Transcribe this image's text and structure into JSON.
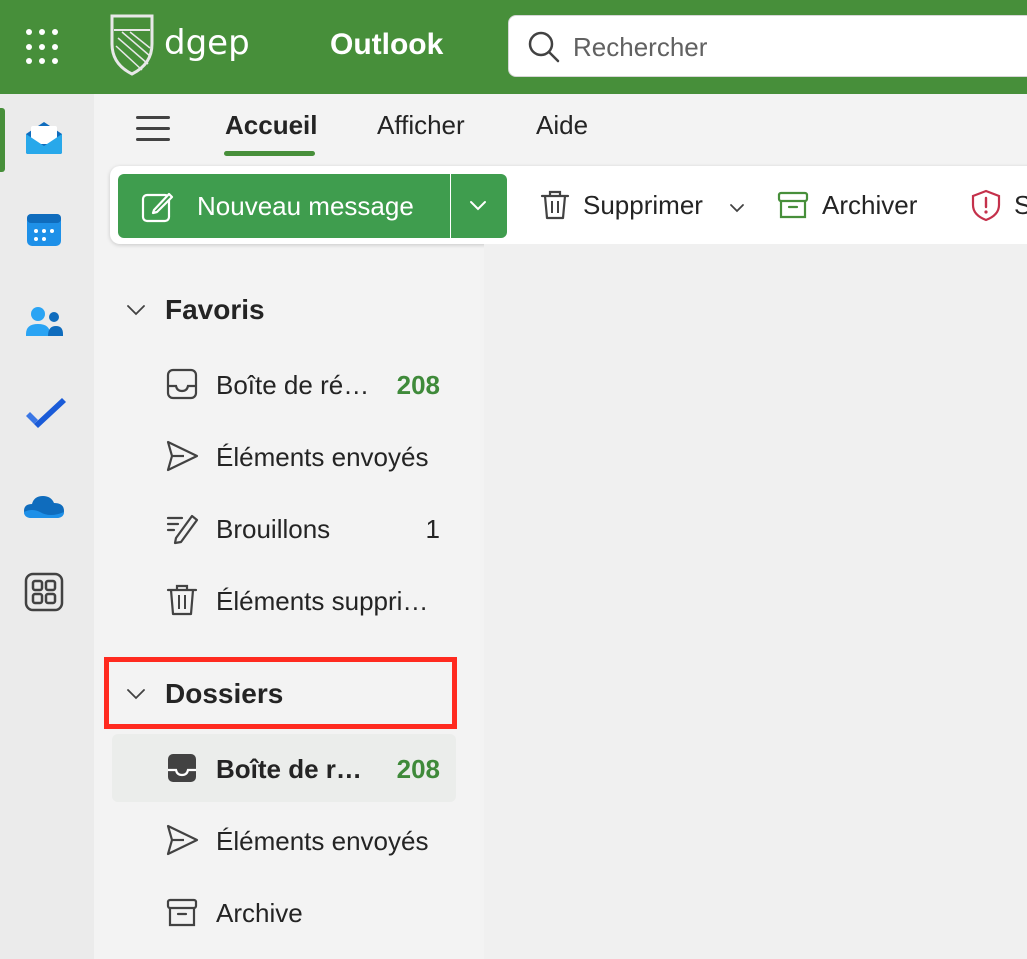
{
  "header": {
    "app_title": "Outlook",
    "org_logo_text": "dgep",
    "search_placeholder": "Rechercher",
    "brand_color": "#478f3a"
  },
  "rail": {
    "items": [
      {
        "name": "mail",
        "icon": "mail-icon",
        "active": true
      },
      {
        "name": "calendar",
        "icon": "calendar-icon"
      },
      {
        "name": "people",
        "icon": "people-icon"
      },
      {
        "name": "todo",
        "icon": "todo-check-icon"
      },
      {
        "name": "onedrive",
        "icon": "onedrive-cloud-icon"
      },
      {
        "name": "apps",
        "icon": "apps-grid-icon"
      }
    ]
  },
  "tabs": [
    {
      "label": "Accueil",
      "active": true
    },
    {
      "label": "Afficher"
    },
    {
      "label": "Aide"
    }
  ],
  "commands": {
    "new_message": "Nouveau message",
    "delete": "Supprimer",
    "archive": "Archiver",
    "report_partial": "S"
  },
  "favorites": {
    "title": "Favoris",
    "items": [
      {
        "label": "Boîte de ré…",
        "count": "208",
        "icon": "inbox-icon",
        "count_color": "green"
      },
      {
        "label": "Éléments envoyés",
        "count": "",
        "icon": "send-icon"
      },
      {
        "label": "Brouillons",
        "count": "1",
        "icon": "draft-pencil-icon"
      },
      {
        "label": "Éléments suppri…",
        "count": "",
        "icon": "trash-icon"
      }
    ]
  },
  "folders": {
    "title": "Dossiers",
    "items": [
      {
        "label": "Boîte de r…",
        "count": "208",
        "icon": "inbox-icon",
        "selected": true,
        "count_color": "green"
      },
      {
        "label": "Éléments envoyés",
        "count": "",
        "icon": "send-icon"
      },
      {
        "label": "Archive",
        "count": "",
        "icon": "archive-icon"
      }
    ]
  },
  "annotation": {
    "highlight_color": "#ff2a1f"
  }
}
